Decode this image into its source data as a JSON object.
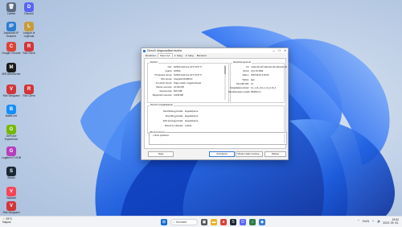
{
  "desktop_icons": [
    {
      "label": "Lomtár",
      "color": "#5d6b82",
      "glyph": "🗑"
    },
    {
      "label": "Discord",
      "color": "#5865f2",
      "glyph": "D"
    },
    {
      "label": "Advanced IP Scanner",
      "color": "#2e7dd1",
      "glyph": "IP"
    },
    {
      "label": "League of Legends",
      "color": "#c89b3c",
      "glyph": "L"
    },
    {
      "label": "Google Chrome",
      "color": "#db4437",
      "glyph": "C"
    },
    {
      "label": "Riot Client",
      "color": "#d13639",
      "glyph": "R"
    },
    {
      "label": "MSI Afterburner",
      "color": "#1b1b1b",
      "glyph": "M"
    },
    {
      "label": "Riot Vanguard",
      "color": "#d13639",
      "glyph": "V"
    },
    {
      "label": "Riot Client",
      "color": "#d13639",
      "glyph": "R"
    },
    {
      "label": "Battle.net",
      "color": "#148eff",
      "glyph": "B"
    },
    {
      "label": "GeForce Experience",
      "color": "#76b900",
      "glyph": "G"
    },
    {
      "label": "Logitech G HUB",
      "color": "#b83dba",
      "glyph": "G"
    },
    {
      "label": "Steam",
      "color": "#1b2838",
      "glyph": "S"
    },
    {
      "label": "Valorant",
      "color": "#fa4454",
      "glyph": "V"
    },
    {
      "label": "Riot Vanguard",
      "color": "#d13639",
      "glyph": "V"
    }
  ],
  "dialog": {
    "title": "DirectX diagnosztikai eszköz",
    "controls": {
      "min": "—",
      "max": "☐",
      "close": "✕"
    },
    "tabs": [
      "Rendszer",
      "Képernyő",
      "1. hang",
      "2. hang",
      "Bemenet"
    ],
    "device": {
      "title": "Eszköz",
      "rows": [
        {
          "k": "Név:",
          "v": "NVIDIA GeForce GTX 1070 Ti"
        },
        {
          "k": "Gyártó:",
          "v": "NVIDIA"
        },
        {
          "k": "Processzor típusa:",
          "v": "NVIDIA GeForce GTX 1070 Ti"
        },
        {
          "k": "DAC típusa:",
          "v": "Integrated RAMDAC"
        },
        {
          "k": "Az eszköz típusa:",
          "v": "Teljes eszköz megjelenítéssel"
        },
        {
          "k": "Összes memória:",
          "v": "24 240 MB"
        },
        {
          "k": "Képmemória:",
          "v": "8072 MB"
        },
        {
          "k": "Megosztott memória:",
          "v": "16168 MB"
        }
      ]
    },
    "drivers": {
      "title": "Illesztőprogramok",
      "rows": [
        {
          "k": "Fő:",
          "v": "nvldumdx.dll,nvldumdx.dll,nvldumdx.dll"
        },
        {
          "k": "Verzió:",
          "v": "31.0.15.3699"
        },
        {
          "k": "Dátum:",
          "v": "2023.08.22 0:00:00"
        },
        {
          "k": "WHQL:",
          "v": "Igen"
        },
        {
          "k": "Direct3D DDI:",
          "v": "12"
        },
        {
          "k": "Szolgáltatási szintek:",
          "v": "12_1,12_0,11_1,11_0,10_1"
        },
        {
          "k": "Illesztőprogram-modell:",
          "v": "WDDM 3.1"
        }
      ]
    },
    "directx": {
      "title": "DirectX-szolgáltatások",
      "rows": [
        {
          "k": "DirectDraw-gyorsítás:",
          "v": "Engedélyezve"
        },
        {
          "k": "Direct3D-gyorsítás:",
          "v": "Engedélyezve"
        },
        {
          "k": "AGP-textúragyorsítás:",
          "v": "Engedélyezve"
        },
        {
          "k": "DirectX 12 Ultimate:",
          "v": "Letiltva"
        }
      ]
    },
    "notes": {
      "title": "Megjegyzések",
      "items": [
        "Nincs probléma."
      ]
    },
    "buttons": {
      "help": "Súgó",
      "next": "Következő",
      "save": "Minden adat mentése...",
      "exit": "Kilépés"
    }
  },
  "taskbar": {
    "weather_temp": "25°C",
    "weather_desc": "Napos",
    "search_placeholder": "Keresés",
    "tray_lang": "HUN",
    "time": "19:52",
    "date": "2023. 09. 04."
  }
}
